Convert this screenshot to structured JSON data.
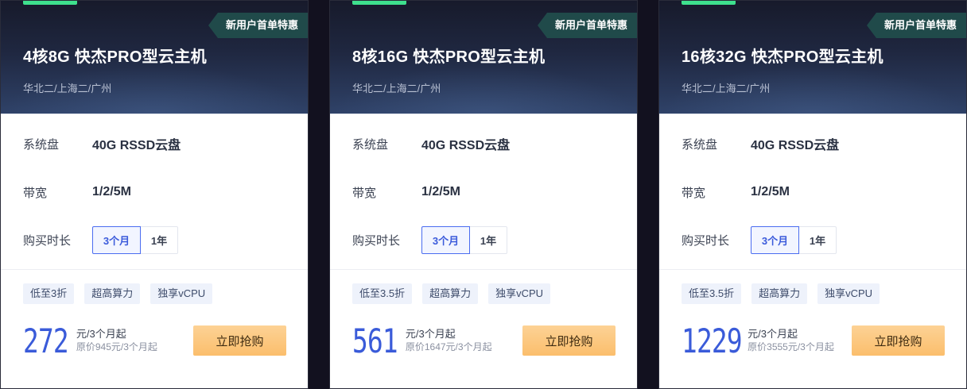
{
  "theme": {
    "accent_green": "#3ee08d",
    "tag_bg": "#204a4a",
    "active_blue": "#3b5bdb",
    "buy_orange": "#fbbe6c",
    "page_bg": "#12111f"
  },
  "cards": [
    {
      "promo_tag": "新用户首单特惠",
      "title": "4核8G 快杰PRO型云主机",
      "regions": "华北二/上海二/广州",
      "specs": {
        "disk_label": "系统盘",
        "disk_value": "40G RSSD云盘",
        "bandwidth_label": "带宽",
        "bandwidth_value": "1/2/5M",
        "duration_label": "购买时长",
        "duration_options": [
          "3个月",
          "1年"
        ],
        "duration_selected": "3个月"
      },
      "tags": [
        "低至3折",
        "超高算力",
        "独享vCPU"
      ],
      "price": "272",
      "price_unit": "元/3个月起",
      "original_price": "原价945元/3个月起",
      "buy_label": "立即抢购"
    },
    {
      "promo_tag": "新用户首单特惠",
      "title": "8核16G 快杰PRO型云主机",
      "regions": "华北二/上海二/广州",
      "specs": {
        "disk_label": "系统盘",
        "disk_value": "40G RSSD云盘",
        "bandwidth_label": "带宽",
        "bandwidth_value": "1/2/5M",
        "duration_label": "购买时长",
        "duration_options": [
          "3个月",
          "1年"
        ],
        "duration_selected": "3个月"
      },
      "tags": [
        "低至3.5折",
        "超高算力",
        "独享vCPU"
      ],
      "price": "561",
      "price_unit": "元/3个月起",
      "original_price": "原价1647元/3个月起",
      "buy_label": "立即抢购"
    },
    {
      "promo_tag": "新用户首单特惠",
      "title": "16核32G 快杰PRO型云主机",
      "regions": "华北二/上海二/广州",
      "specs": {
        "disk_label": "系统盘",
        "disk_value": "40G RSSD云盘",
        "bandwidth_label": "带宽",
        "bandwidth_value": "1/2/5M",
        "duration_label": "购买时长",
        "duration_options": [
          "3个月",
          "1年"
        ],
        "duration_selected": "3个月"
      },
      "tags": [
        "低至3.5折",
        "超高算力",
        "独享vCPU"
      ],
      "price": "1229",
      "price_unit": "元/3个月起",
      "original_price": "原价3555元/3个月起",
      "buy_label": "立即抢购"
    }
  ]
}
